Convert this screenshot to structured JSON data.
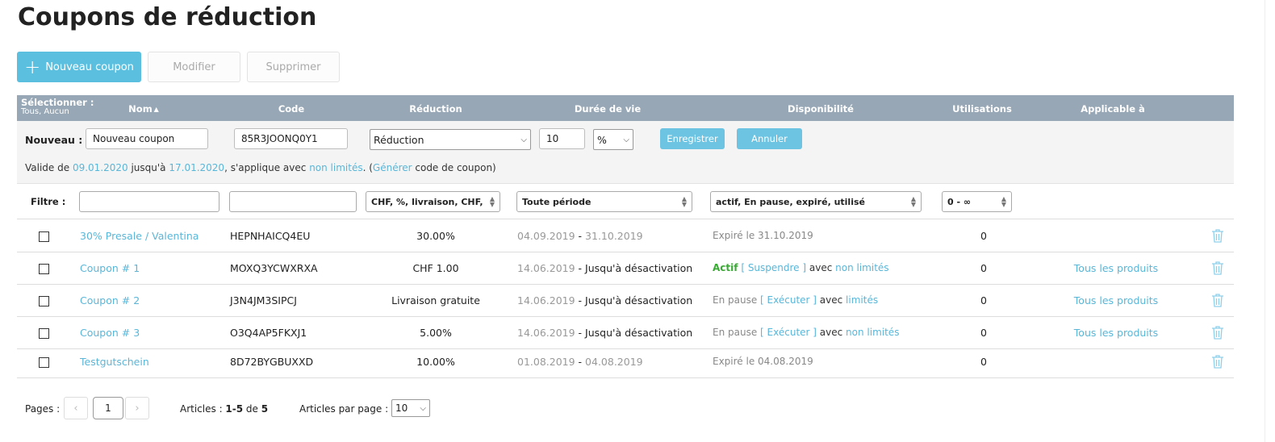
{
  "page": {
    "title": "Coupons de réduction"
  },
  "toolbar": {
    "new_label": "Nouveau coupon",
    "edit_label": "Modifier",
    "delete_label": "Supprimer"
  },
  "table_header": {
    "select_label": "Sélectionner :",
    "select_sub": "Tous, Aucun",
    "cols": {
      "nom": "Nom",
      "code": "Code",
      "reduction": "Réduction",
      "duree": "Durée de vie",
      "disponibilite": "Disponibilité",
      "utilisations": "Utilisations",
      "applicable": "Applicable à"
    }
  },
  "new_row": {
    "label": "Nouveau :",
    "name_value": "Nouveau coupon",
    "code_value": "85R3JOONQ0Y1",
    "type_value": "Réduction",
    "amount_value": "10",
    "unit_value": "%",
    "save_label": "Enregistrer",
    "cancel_label": "Annuler",
    "validity": {
      "prefix": "Valide de ",
      "from": "09.01.2020",
      "mid": " jusqu'à ",
      "to": "17.01.2020",
      "applies": ", s'applique avec ",
      "limit": "non limités",
      "paren_open": ". (",
      "generate": "Générer",
      "suffix": " code de coupon)"
    }
  },
  "filter": {
    "label": "Filtre :",
    "name_value": "",
    "code_value": "",
    "reduction_value": "CHF, %, livraison, CHF,",
    "period_value": "Toute période",
    "status_value": "actif, En pause, expiré, utilisé",
    "uses_value": "0 - ∞"
  },
  "rows": [
    {
      "nom": "30% Presale / Valentina",
      "code": "HEPNHAICQ4EU",
      "reduction": "30.00%",
      "dur_start": "04.09.2019",
      "dur_sep": " - ",
      "dur_end": "31.10.2019",
      "disp_status": "Expiré le 31.10.2019",
      "disp_action": "",
      "disp_avec": "",
      "disp_limit": "",
      "uses": "0",
      "applicable": ""
    },
    {
      "nom": "Coupon # 1",
      "code": "MOXQ3YCWXRXA",
      "reduction": "CHF 1.00",
      "dur_start": "14.06.2019",
      "dur_sep": " - ",
      "dur_end": "Jusqu'à désactivation",
      "disp_status": "Actif",
      "disp_action": "Suspendre",
      "disp_avec": " avec ",
      "disp_limit": "non limités",
      "uses": "0",
      "applicable": "Tous les produits"
    },
    {
      "nom": "Coupon # 2",
      "code": "J3N4JM3SIPCJ",
      "reduction": "Livraison gratuite",
      "dur_start": "14.06.2019",
      "dur_sep": " - ",
      "dur_end": "Jusqu'à désactivation",
      "disp_status": "En pause",
      "disp_action": "Exécuter",
      "disp_avec": " avec ",
      "disp_limit": "limités",
      "uses": "0",
      "applicable": "Tous les produits"
    },
    {
      "nom": "Coupon # 3",
      "code": "O3Q4AP5FKXJ1",
      "reduction": "5.00%",
      "dur_start": "14.06.2019",
      "dur_sep": " - ",
      "dur_end": "Jusqu'à désactivation",
      "disp_status": "En pause",
      "disp_action": "Exécuter",
      "disp_avec": " avec ",
      "disp_limit": "non limités",
      "uses": "0",
      "applicable": "Tous les produits"
    },
    {
      "nom": "Testgutschein",
      "code": "8D72BYGBUXXD",
      "reduction": "10.00%",
      "dur_start": "01.08.2019",
      "dur_sep": " - ",
      "dur_end": "04.08.2019",
      "disp_status": "Expiré le 04.08.2019",
      "disp_action": "",
      "disp_avec": "",
      "disp_limit": "",
      "uses": "0",
      "applicable": ""
    }
  ],
  "pager": {
    "pages_label": "Pages :",
    "prev": "‹",
    "current": "1",
    "next": "›",
    "articles_label": "Articles : ",
    "articles_range": "1-5",
    "articles_de": " de ",
    "articles_total": "5",
    "per_page_label": "Articles par page :",
    "per_page_value": "10"
  },
  "colors": {
    "accent": "#5bbfe0",
    "header_bg": "#97a7b5",
    "active": "#3aaa35",
    "link": "#5ab6d8"
  }
}
